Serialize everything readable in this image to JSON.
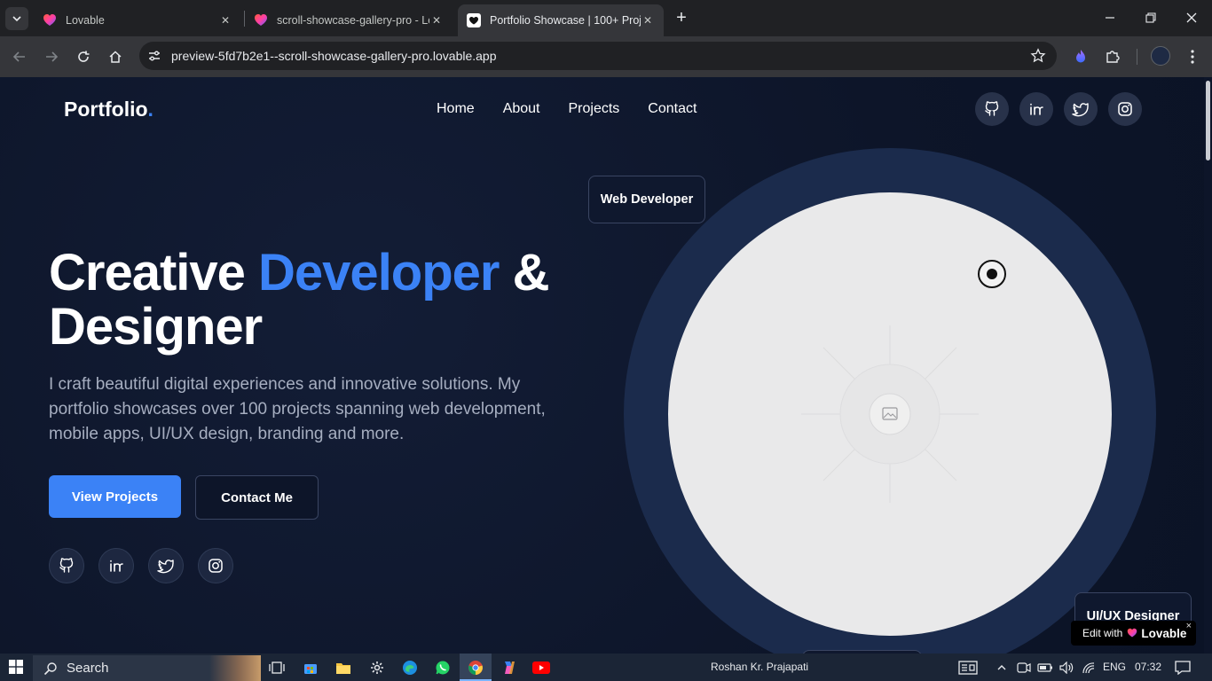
{
  "browser": {
    "tabs": [
      {
        "title": "Lovable",
        "active": false
      },
      {
        "title": "scroll-showcase-gallery-pro - Lo",
        "active": false
      },
      {
        "title": "Portfolio Showcase | 100+ Proje",
        "active": true
      }
    ],
    "url": "preview-5fd7b2e1--scroll-showcase-gallery-pro.lovable.app"
  },
  "site": {
    "logo_text": "Portfolio",
    "logo_dot": ".",
    "nav": [
      "Home",
      "About",
      "Projects",
      "Contact"
    ],
    "social_icons": [
      "github-icon",
      "linkedin-icon",
      "twitter-icon",
      "instagram-icon"
    ],
    "hero": {
      "title_part1": "Creative ",
      "title_accent": "Developer",
      "title_part2": " & Designer",
      "description": "I craft beautiful digital experiences and innovative solutions. My portfolio showcases over 100 projects spanning web development, mobile apps, UI/UX design, branding and more.",
      "primary_button": "View Projects",
      "secondary_button": "Contact Me"
    },
    "badges": {
      "top": "Web Developer",
      "bottom_right": "UI/UX Designer"
    },
    "lovable_badge": {
      "prefix": "Edit with",
      "name": "Lovable",
      "close": "×"
    },
    "colors": {
      "accent": "#3b82f6",
      "background": "#0d1529",
      "ring": "#1b2b4c"
    }
  },
  "taskbar": {
    "search_placeholder": "Search",
    "user": "Roshan Kr. Prajapati",
    "language": "ENG",
    "time": "07:32"
  }
}
